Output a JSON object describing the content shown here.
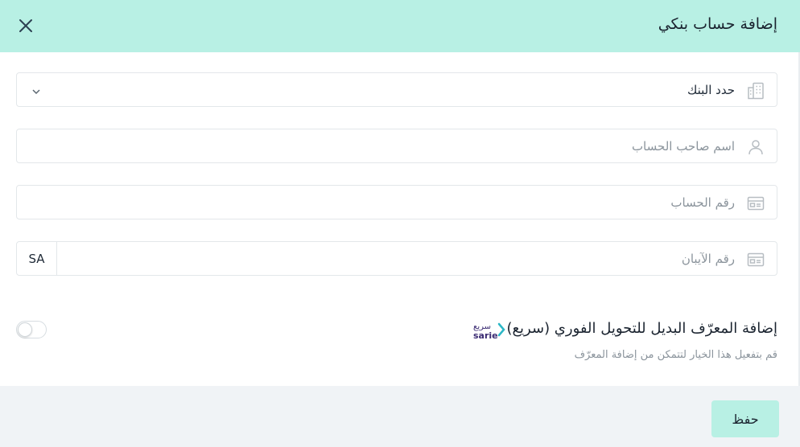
{
  "dialog": {
    "title": "إضافة حساب بنكي",
    "close_icon": "close-icon"
  },
  "fields": {
    "bank": {
      "label": "حدد البنك",
      "icon": "building-icon"
    },
    "holder": {
      "placeholder": "اسم صاحب الحساب",
      "icon": "user-icon"
    },
    "account": {
      "placeholder": "رقم الحساب",
      "icon": "card-icon"
    },
    "iban": {
      "placeholder": "رقم الآيبان",
      "prefix": "SA",
      "icon": "card-icon"
    }
  },
  "sarie": {
    "title": "إضافة المعرّف البديل للتحويل الفوري (سريع)",
    "description": "قم بتفعيل هذا الخيار لتتمكن من إضافة المعرّف",
    "logo_text_ar": "سريع",
    "logo_text_en": "sarie",
    "enabled": false
  },
  "footer": {
    "save_label": "حفظ"
  },
  "colors": {
    "accent": "#b8f0e4",
    "footer_bg": "#f0f3f6",
    "text": "#1b2430",
    "muted": "#8b949c"
  }
}
